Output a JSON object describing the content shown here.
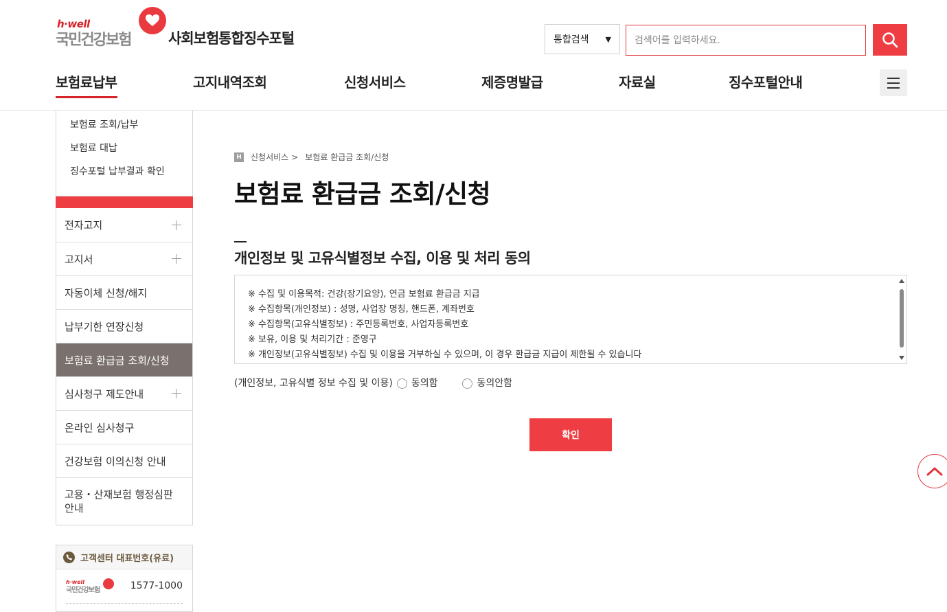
{
  "brand": {
    "hwell": "h·well",
    "org_name": "국민건강보험",
    "portal_title": "사회보험통합징수포털",
    "accent_color": "#ee3e43"
  },
  "search": {
    "scope_selected": "통합검색",
    "placeholder": "검색어를 입력하세요.",
    "button_icon": "search-icon"
  },
  "gnb": {
    "items": [
      "보험료납부",
      "고지내역조회",
      "신청서비스",
      "제증명발급",
      "자료실",
      "징수포털안내"
    ],
    "active_index": 0,
    "menu_icon": "hamburger-icon"
  },
  "sidebar": {
    "sub_items": [
      "보험료 조회/납부",
      "보험료 대납",
      "징수포털 납부결과 확인"
    ],
    "menu": [
      {
        "label": "전자고지",
        "expandable": true
      },
      {
        "label": "고지서",
        "expandable": true
      },
      {
        "label": "자동이체 신청/해지",
        "expandable": false
      },
      {
        "label": "납부기한 연장신청",
        "expandable": false
      },
      {
        "label": "보험료 환급금 조회/신청",
        "expandable": false,
        "active": true
      },
      {
        "label": "심사청구 제도안내",
        "expandable": true
      },
      {
        "label": "온라인 심사청구",
        "expandable": false
      },
      {
        "label": "건강보험 이의신청 안내",
        "expandable": false
      },
      {
        "label": "고용・산재보험 행정심판 안내",
        "expandable": false
      }
    ]
  },
  "customer_center": {
    "title": "고객센터 대표번호(유료)",
    "org_hwell": "h·well",
    "org_name": "국민건강보험",
    "number": "1577-1000"
  },
  "breadcrumb": {
    "home_icon": "H",
    "items": [
      "신청서비스",
      ">",
      "보험료 환급금 조회/신청"
    ]
  },
  "page": {
    "title": "보험료 환급금 조회/신청",
    "section_title": "개인정보 및 고유식별정보 수집, 이용 및 처리 동의",
    "terms": [
      "※ 수집 및 이용목적: 건강(장기요양), 연금 보험료 환급금 지급",
      "※ 수집항목(개인정보) : 성명, 사업장 명칭, 핸드폰, 계좌번호",
      "※ 수집항목(고유식별정보) : 주민등록번호, 사업자등록번호",
      "※ 보유, 이용 및 처리기간 : 준영구",
      "※ 개인정보(고유식별정보) 수집 및 이용을 거부하실 수 있으며, 이 경우 환급금 지급이 제한될 수 있습니다"
    ],
    "agree_label": "(개인정보, 고유식별 정보 수집 및 이용)",
    "agree_option": "동의함",
    "disagree_option": "동의안함",
    "confirm_label": "확인",
    "top_icon": "chevron-up-icon"
  }
}
